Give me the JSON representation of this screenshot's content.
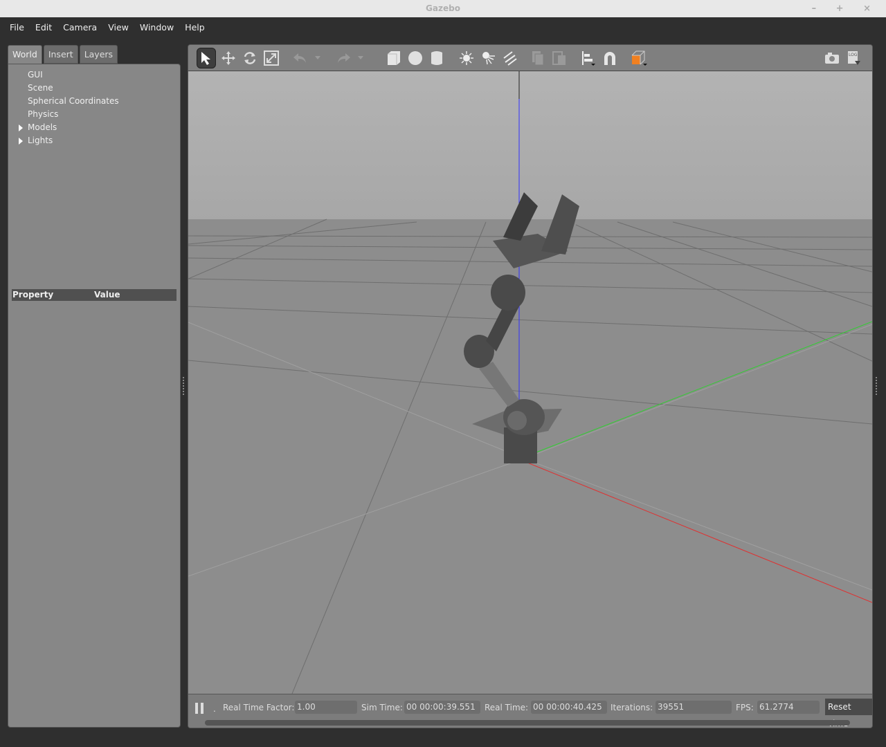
{
  "window": {
    "title": "Gazebo",
    "controls": "– + ×"
  },
  "menu": [
    {
      "label": "File"
    },
    {
      "label": "Edit"
    },
    {
      "label": "Camera"
    },
    {
      "label": "View"
    },
    {
      "label": "Window"
    },
    {
      "label": "Help"
    }
  ],
  "left_tabs": [
    {
      "label": "World",
      "active": true
    },
    {
      "label": "Insert"
    },
    {
      "label": "Layers"
    }
  ],
  "tree": [
    {
      "label": "GUI"
    },
    {
      "label": "Scene"
    },
    {
      "label": "Spherical Coordinates"
    },
    {
      "label": "Physics"
    },
    {
      "label": "Models",
      "expandable": true
    },
    {
      "label": "Lights",
      "expandable": true
    }
  ],
  "property_table": {
    "col1": "Property",
    "col2": "Value"
  },
  "toolbar": {
    "icons": [
      "select-arrow-icon",
      "translate-icon",
      "rotate-icon",
      "scale-icon",
      "undo-icon",
      "redo-icon",
      "box-icon",
      "sphere-icon",
      "cylinder-icon",
      "point-light-icon",
      "spot-light-icon",
      "directional-light-icon",
      "copy-icon",
      "paste-icon",
      "align-icon",
      "magnet-icon",
      "view-angle-icon",
      "screenshot-icon",
      "log-icon"
    ],
    "accent": "#f08020"
  },
  "status": {
    "rtf_label": "Real Time Factor:",
    "rtf": "1.00",
    "sim_label": "Sim Time:",
    "sim": "00 00:00:39.551",
    "real_label": "Real Time:",
    "real": "00 00:00:40.425",
    "iter_label": "Iterations:",
    "iter": "39551",
    "fps_label": "FPS:",
    "fps": "61.2774",
    "reset": "Reset Time",
    "step": "."
  },
  "colors": {
    "x_axis": "#e03030",
    "y_axis": "#30d030",
    "z_axis": "#3030ff"
  }
}
